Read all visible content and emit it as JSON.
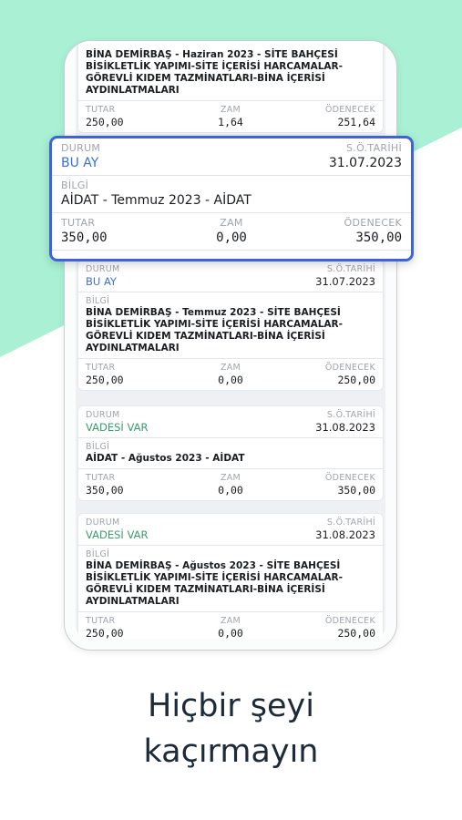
{
  "colors": {
    "mint": "#a9f0d4",
    "accent_blue": "#3c64d8",
    "status_green": "#3a9d6c"
  },
  "labels": {
    "durum": "DURUM",
    "so_tarihi": "S.Ö.TARİHİ",
    "bilgi": "BİLGİ",
    "tutar": "TUTAR",
    "zam": "ZAM",
    "odenecek": "ÖDENECEK"
  },
  "card0": {
    "info": "BİNA DEMİRBAŞ - Haziran 2023 - SİTE BAHÇESİ BİSİKLETLİK YAPIMI-SİTE İÇERİSİ HARCAMALAR-GÖREVLİ KIDEM TAZMİNATLARI-BİNA İÇERİSİ AYDINLATMALARI",
    "tutar": "250,00",
    "zam": "1,64",
    "odenecek": "251,64"
  },
  "highlight": {
    "status": "BU AY",
    "date": "31.07.2023",
    "info": "AİDAT - Temmuz 2023 - AİDAT",
    "tutar": "350,00",
    "zam": "0,00",
    "odenecek": "350,00"
  },
  "card1": {
    "status": "BU AY",
    "date": "31.07.2023",
    "info": "BİNA DEMİRBAŞ - Temmuz 2023 - SİTE BAHÇESİ BİSİKLETLİK YAPIMI-SİTE İÇERİSİ HARCAMALAR-GÖREVLİ KIDEM TAZMİNATLARI-BİNA İÇERİSİ AYDINLATMALARI",
    "tutar": "250,00",
    "zam": "0,00",
    "odenecek": "250,00"
  },
  "card2": {
    "status": "VADESİ VAR",
    "date": "31.08.2023",
    "info": "AİDAT - Ağustos 2023 - AİDAT",
    "tutar": "350,00",
    "zam": "0,00",
    "odenecek": "350,00"
  },
  "card3": {
    "status": "VADESİ VAR",
    "date": "31.08.2023",
    "info": "BİNA DEMİRBAŞ - Ağustos 2023 - SİTE BAHÇESİ BİSİKLETLİK YAPIMI-SİTE İÇERİSİ HARCAMALAR-GÖREVLİ KIDEM TAZMİNATLARI-BİNA İÇERİSİ AYDINLATMALARI",
    "tutar": "250,00",
    "zam": "0,00",
    "odenecek": "250,00"
  },
  "caption": {
    "line1": "Hiçbir şeyi",
    "line2": "kaçırmayın"
  }
}
